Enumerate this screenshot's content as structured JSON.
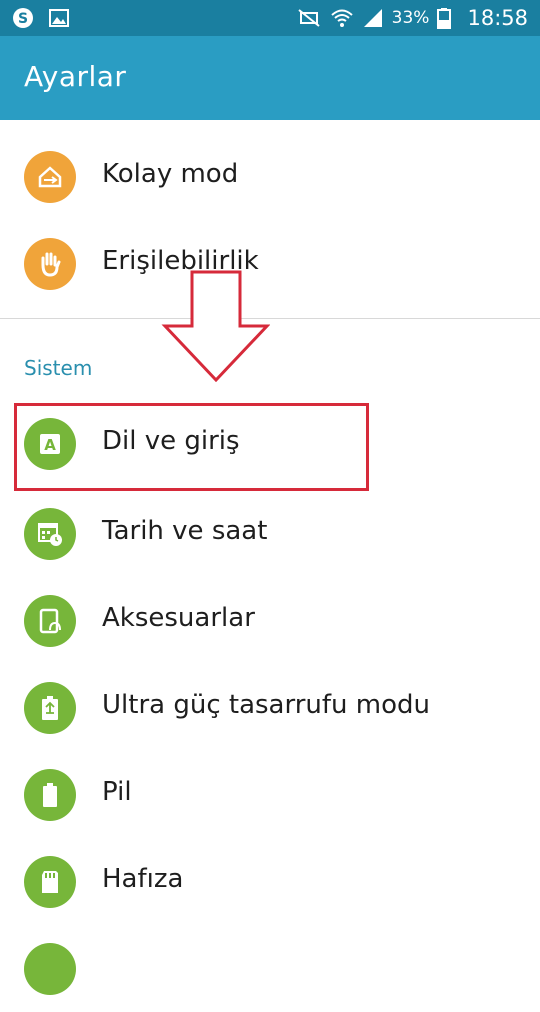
{
  "status_bar": {
    "battery": "33%",
    "time": "18:58",
    "icons": [
      "skype-icon",
      "image-icon",
      "mute-icon",
      "wifi-icon",
      "signal-icon",
      "battery-icon"
    ]
  },
  "action_bar": {
    "title": "Ayarlar"
  },
  "items_top": [
    {
      "label": "Kolay mod",
      "icon": "easy-mode-icon",
      "color": "#f0a43a"
    },
    {
      "label": "Erişilebilirlik",
      "icon": "hand-icon",
      "color": "#f0a43a"
    }
  ],
  "section": {
    "title": "Sistem"
  },
  "items_system": [
    {
      "label": "Dil ve giriş",
      "icon": "language-icon",
      "color": "#77b63a"
    },
    {
      "label": "Tarih ve saat",
      "icon": "calendar-clock-icon",
      "color": "#77b63a"
    },
    {
      "label": "Aksesuarlar",
      "icon": "accessory-icon",
      "color": "#77b63a"
    },
    {
      "label": "Ultra güç tasarrufu modu",
      "icon": "power-saving-icon",
      "color": "#77b63a"
    },
    {
      "label": "Pil",
      "icon": "battery-icon",
      "color": "#77b63a"
    },
    {
      "label": "Hafıza",
      "icon": "sd-card-icon",
      "color": "#77b63a"
    }
  ],
  "colors": {
    "status_bar": "#1a7fa0",
    "action_bar": "#2a9dc3",
    "section_header": "#2a8fae",
    "highlight": "#d62a3a"
  }
}
